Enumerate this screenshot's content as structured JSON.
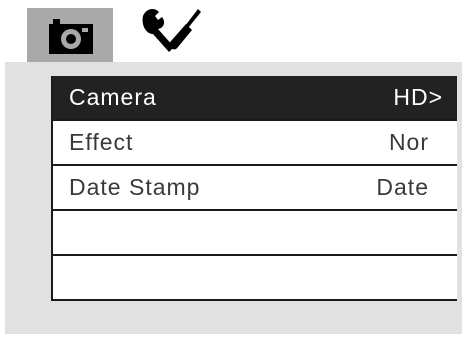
{
  "tabs": [
    {
      "icon": "camera-icon",
      "active": true
    },
    {
      "icon": "wrench-screwdriver-icon",
      "active": false
    }
  ],
  "menu": {
    "items": [
      {
        "label": "Camera",
        "value": "HD>",
        "selected": true
      },
      {
        "label": "Effect",
        "value": "Nor",
        "selected": false
      },
      {
        "label": "Date Stamp",
        "value": "Date",
        "selected": false
      }
    ]
  },
  "colors": {
    "active_tab": "#a9a9a9",
    "panel_bg": "#e1e1e1",
    "selected_row": "#222222",
    "divider": "#1a1a1a"
  }
}
